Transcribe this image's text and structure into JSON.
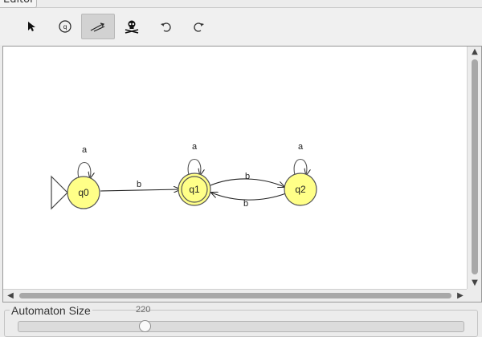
{
  "tabs": [
    {
      "label": "Editor"
    }
  ],
  "toolbar": {
    "tools": [
      {
        "icon": "pointer-arrow-icon",
        "selected": false
      },
      {
        "icon": "add-state-icon",
        "selected": false
      },
      {
        "icon": "add-transition-icon",
        "selected": true
      },
      {
        "icon": "delete-skull-icon",
        "selected": false
      },
      {
        "icon": "undo-icon",
        "selected": false
      },
      {
        "icon": "redo-icon",
        "selected": false
      }
    ]
  },
  "automaton": {
    "states": [
      {
        "id": "q0",
        "label": "q0",
        "initial": true,
        "final": false
      },
      {
        "id": "q1",
        "label": "q1",
        "initial": false,
        "final": true
      },
      {
        "id": "q2",
        "label": "q2",
        "initial": false,
        "final": false
      }
    ],
    "transitions": [
      {
        "from": "q0",
        "to": "q0",
        "label": "a"
      },
      {
        "from": "q0",
        "to": "q1",
        "label": "b"
      },
      {
        "from": "q1",
        "to": "q1",
        "label": "a"
      },
      {
        "from": "q1",
        "to": "q2",
        "label": "b"
      },
      {
        "from": "q2",
        "to": "q1",
        "label": "b"
      },
      {
        "from": "q2",
        "to": "q2",
        "label": "a"
      }
    ],
    "state_fill": "#ffff88",
    "state_stroke": "#555555"
  },
  "size_panel": {
    "title": "Automaton Size",
    "value": "220",
    "slider_fraction": 0.28
  }
}
